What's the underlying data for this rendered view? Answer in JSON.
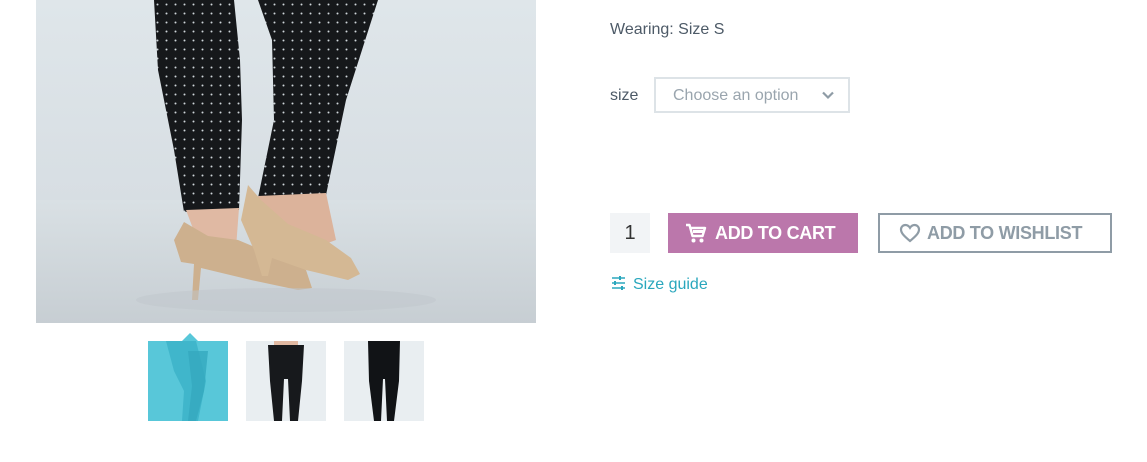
{
  "product": {
    "wearing": "Wearing: Size S",
    "size_label": "size",
    "size_select_placeholder": "Choose an option",
    "quantity": "1",
    "add_to_cart_label": "ADD TO CART",
    "add_to_wishlist_label": "ADD TO WISHLIST",
    "size_guide_label": "Size guide"
  },
  "gallery": {
    "main_image_icon": "product-photo-pants-heels",
    "thumbnails": [
      {
        "name": "thumbnail-1",
        "selected": true
      },
      {
        "name": "thumbnail-2",
        "selected": false
      },
      {
        "name": "thumbnail-3",
        "selected": false
      }
    ]
  },
  "colors": {
    "accent_cart": "#bb77ab",
    "accent_link": "#2aa7bd",
    "selected_thumb": "#58c7d9",
    "wishlist_border": "#8f9ca6"
  }
}
